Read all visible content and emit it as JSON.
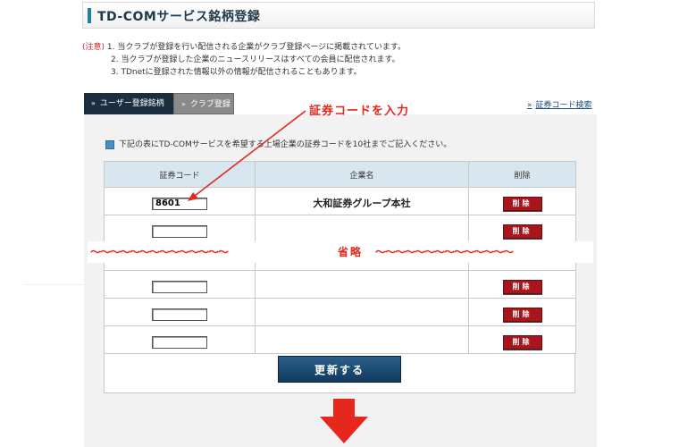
{
  "header": {
    "title": "TD-COMサービス銘柄登録"
  },
  "notes": {
    "prefix": "(注意)",
    "items": [
      "1. 当クラブが登録を行い配信される企業がクラブ登録ページに掲載されています。",
      "2. 当クラブが登録した企業のニュースリリースはすべての会員に配信されます。",
      "3. TDnetに登録された情報以外の情報が配信されることもあります。"
    ]
  },
  "tabs": [
    {
      "label": "ユーザー登録銘柄",
      "active": true
    },
    {
      "label": "クラブ登録",
      "active": false
    }
  ],
  "links": {
    "code_search": "証券コード検索"
  },
  "instruction": "下記の表にTD-COMサービスを希望する上場企業の証券コードを10社までご記入ください。",
  "table": {
    "headers": [
      "証券コード",
      "企業名",
      "削除"
    ],
    "rows_top": [
      {
        "code": "8601",
        "company": "大和証券グループ本社"
      },
      {
        "code": "",
        "company": ""
      }
    ],
    "rows_bottom": [
      {
        "code": "",
        "company": ""
      },
      {
        "code": "",
        "company": ""
      },
      {
        "code": "",
        "company": ""
      }
    ],
    "delete_label": "削除"
  },
  "annotations": {
    "callout": "証券コードを入力",
    "omission_wave": "〜〜〜〜〜〜〜〜〜〜〜〜〜〜",
    "omission_label": "省略"
  },
  "buttons": {
    "update": "更新する"
  },
  "colors": {
    "accent_red": "#e6271d",
    "tab_dark": "#1a2e3f",
    "delete_red": "#a8151b",
    "update_blue": "#1d4d75"
  }
}
